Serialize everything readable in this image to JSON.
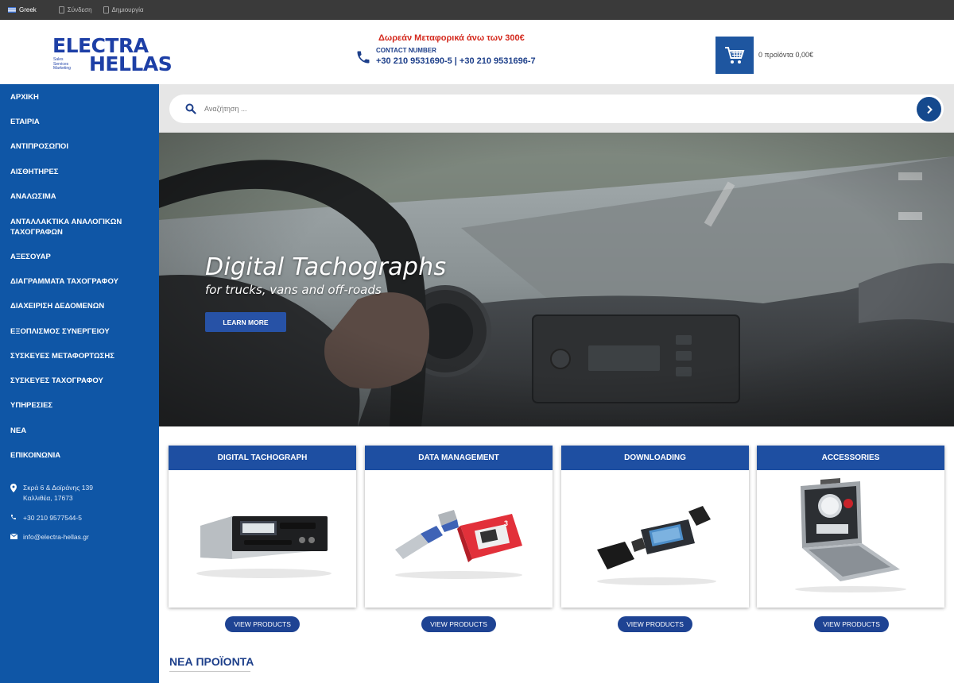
{
  "topbar": {
    "language": "Greek",
    "login": "Σύνδεση",
    "register": "Δημιουργία"
  },
  "header": {
    "logo_line1": "ELECTRA",
    "logo_line2": "HELLAS",
    "logo_tagline": [
      "Sales",
      "Services",
      "Marketing"
    ],
    "promo": "Δωρεάν Μεταφορικά άνω των 300€",
    "contact_label": "CONTACT NUMBER",
    "contact_numbers": "+30 210 9531690-5 | +30 210 9531696-7",
    "cart_summary": "0 προϊόντα 0,00€"
  },
  "sidebar": {
    "items": [
      {
        "label": "ΑΡΧΙΚΗ"
      },
      {
        "label": "ΕΤΑΙΡΙΑ"
      },
      {
        "label": "ΑΝΤΙΠΡΟΣΩΠΟΙ"
      },
      {
        "label": "ΑΙΣΘΗΤΗΡΕΣ"
      },
      {
        "label": "ΑΝΑΛΩΣΙΜΑ"
      },
      {
        "label": "ΑΝΤΑΛΛΑΚΤΙΚΑ ΑΝΑΛΟΓΙΚΩΝ ΤΑΧΟΓΡΑΦΩΝ"
      },
      {
        "label": "ΑΞΕΣΟΥΑΡ"
      },
      {
        "label": "ΔΙΑΓΡΑΜΜΑΤΑ ΤΑΧΟΓΡΑΦΟΥ"
      },
      {
        "label": "ΔΙΑΧΕΙΡΙΣΗ ΔΕΔΟΜΕΝΩΝ"
      },
      {
        "label": "ΕΞΟΠΛΙΣΜΟΣ ΣΥΝΕΡΓΕΙΟΥ"
      },
      {
        "label": "ΣΥΣΚΕΥΕΣ ΜΕΤΑΦΟΡΤΩΣΗΣ"
      },
      {
        "label": "ΣΥΣΚΕΥΕΣ ΤΑΧΟΓΡΑΦΟΥ"
      },
      {
        "label": "ΥΠΗΡΕΣΙΕΣ"
      },
      {
        "label": "ΝΕΑ"
      },
      {
        "label": "ΕΠΙΚΟΙΝΩΝΙΑ"
      }
    ],
    "address_line1": "Σκρά 6 & Δοϊράνης 139",
    "address_line2": "Καλλιθέα, 17673",
    "phone": "+30 210 9577544-5",
    "email": "info@electra-hellas.gr"
  },
  "search": {
    "placeholder": "Αναζήτηση ..."
  },
  "hero": {
    "title": "Digital Tachographs",
    "subtitle": "for trucks, vans and off-roads",
    "button": "LEARN MORE"
  },
  "categories": [
    {
      "title": "DIGITAL TACHOGRAPH",
      "button": "VIEW PRODUCTS"
    },
    {
      "title": "DATA MANAGEMENT",
      "button": "VIEW PRODUCTS"
    },
    {
      "title": "DOWNLOADING",
      "button": "VIEW PRODUCTS"
    },
    {
      "title": "ACCESSORIES",
      "button": "VIEW PRODUCTS"
    }
  ],
  "new_products": {
    "title": "ΝΕΑ ΠΡΟΪΟΝΤΑ"
  },
  "colors": {
    "sidebar": "#0f56a6",
    "accent": "#1e4fa2",
    "promo": "#d42a1e",
    "topbar": "#3a3a3a"
  }
}
